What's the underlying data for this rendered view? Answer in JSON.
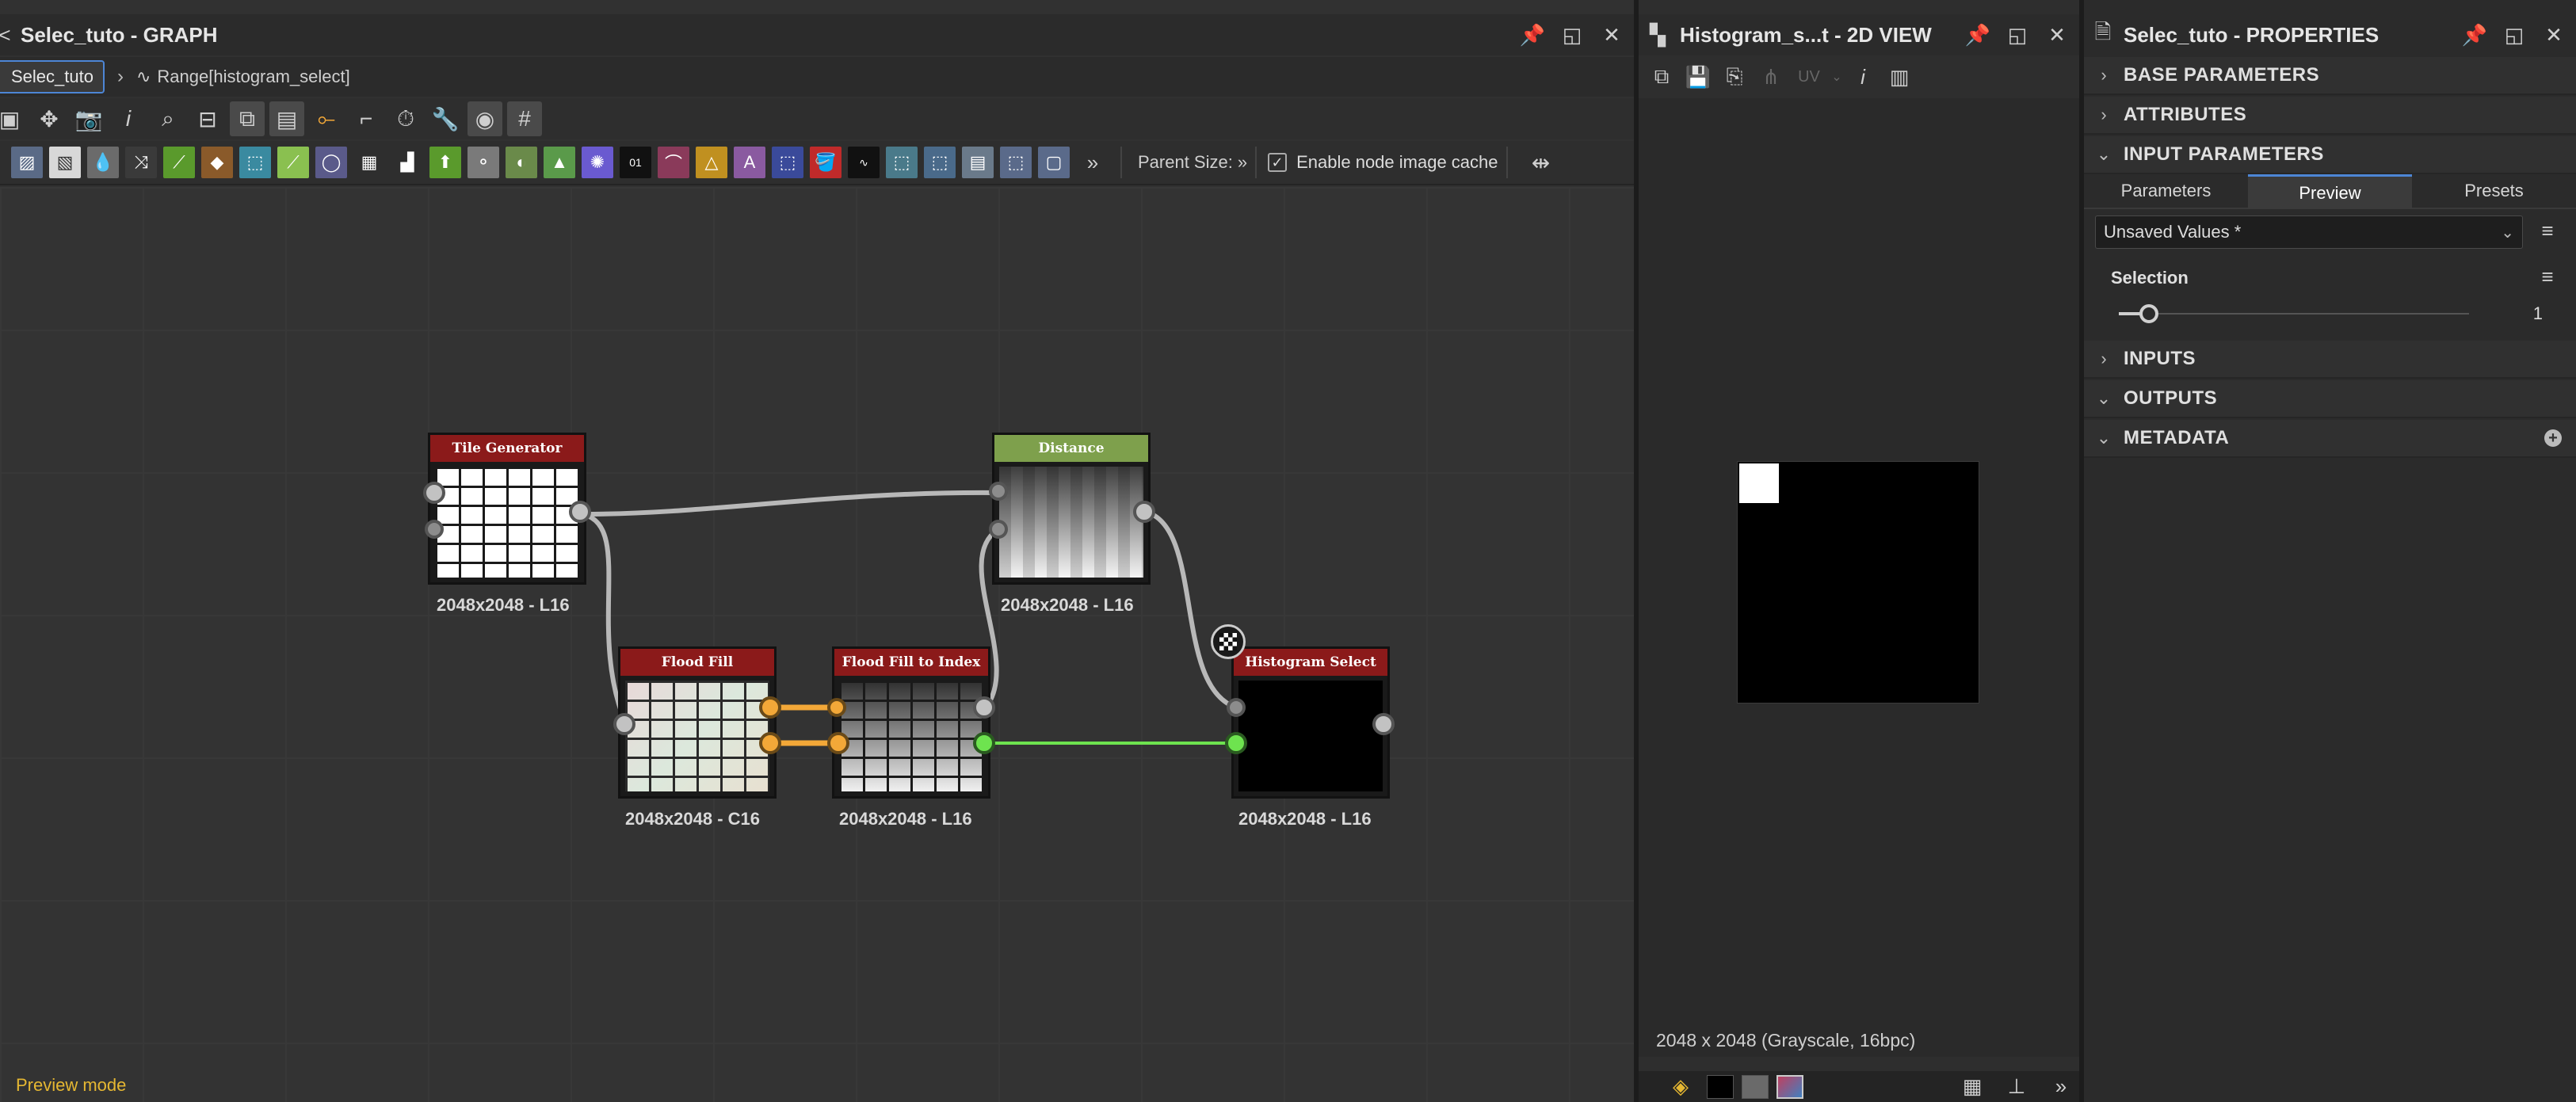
{
  "graph": {
    "title": "Selec_tuto - GRAPH",
    "breadcrumb": {
      "current": "Selec_tuto",
      "item": "Range[histogram_select]"
    },
    "toolbar": {
      "parent_size_label": "Parent Size:",
      "enable_cache_label": "Enable node image cache",
      "more_glyph": "»"
    },
    "preview_mode": "Preview mode",
    "nodes": [
      {
        "id": "tile-generator",
        "title": "Tile Generator",
        "header_color": "#8b1a1a",
        "resolution": "2048x2048 - L16"
      },
      {
        "id": "distance",
        "title": "Distance",
        "header_color": "#7ea04c",
        "resolution": "2048x2048 - L16"
      },
      {
        "id": "flood-fill",
        "title": "Flood Fill",
        "header_color": "#8b1a1a",
        "resolution": "2048x2048 - C16"
      },
      {
        "id": "flood-fill-to-index",
        "title": "Flood Fill to Index",
        "header_color": "#8b1a1a",
        "resolution": "2048x2048 - L16"
      },
      {
        "id": "histogram-select",
        "title": "Histogram Select",
        "header_color": "#8b1a1a",
        "resolution": "2048x2048 - L16"
      }
    ]
  },
  "view2d": {
    "title": "Histogram_s...t - 2D VIEW",
    "uv_label": "UV",
    "status": "2048 x 2048 (Grayscale, 16bpc)"
  },
  "properties": {
    "title": "Selec_tuto - PROPERTIES",
    "sections": {
      "base": "BASE PARAMETERS",
      "attributes": "ATTRIBUTES",
      "input_params": "INPUT PARAMETERS",
      "inputs": "INPUTS",
      "outputs": "OUTPUTS",
      "metadata": "METADATA"
    },
    "tabs": [
      "Parameters",
      "Preview",
      "Presets"
    ],
    "preset_value": "Unsaved Values *",
    "selection": {
      "label": "Selection",
      "value": "1",
      "min": 1,
      "max": 30
    }
  },
  "colors": {
    "accent": "#4d86d6",
    "wire_orange": "#f3a838",
    "wire_green": "#6ee34f",
    "node_red": "#8b1a1a",
    "node_green": "#7ea04c"
  }
}
